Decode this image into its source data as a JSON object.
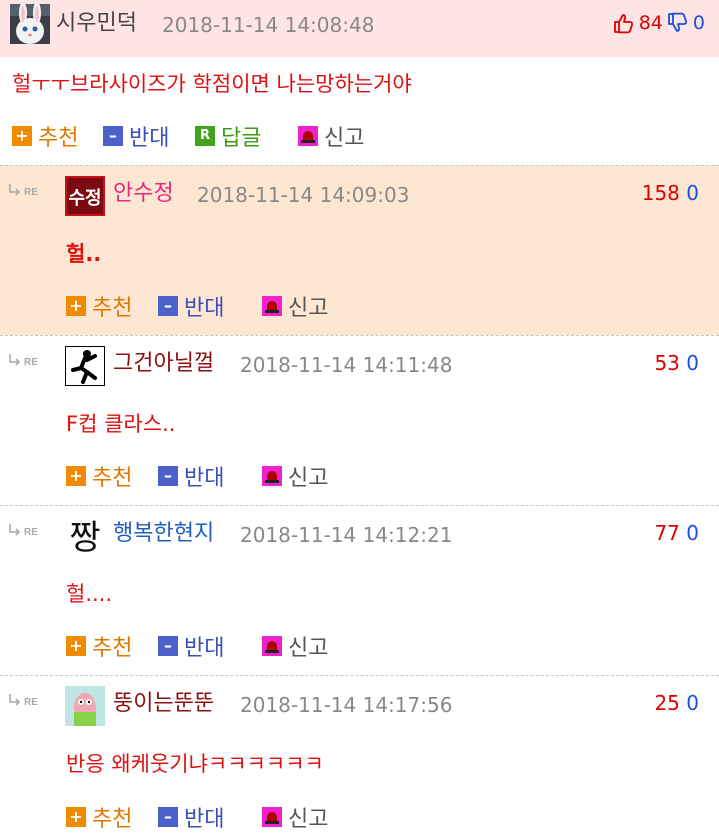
{
  "main": {
    "author": "시우민덕",
    "timestamp": "2018-11-14 14:08:48",
    "upvotes": "84",
    "downvotes": "0",
    "body": "헐ㅜㅜ브라사이즈가 학점이면 나는망하는거야",
    "actions": {
      "recommend": "추천",
      "oppose": "반대",
      "reply": "답글",
      "report": "신고",
      "reply_icon_letter": "R"
    },
    "colors": {
      "header_bg": "#ffe4e6",
      "author": "#444444"
    }
  },
  "replies": [
    {
      "author": "안수정",
      "author_color": "#e8277c",
      "timestamp": "2018-11-14 14:09:03",
      "upvotes": "158",
      "downvotes": "0",
      "body": "헐..",
      "highlighted": true
    },
    {
      "author": "그건아닐껄",
      "author_color": "#8b1010",
      "timestamp": "2018-11-14 14:11:48",
      "upvotes": "53",
      "downvotes": "0",
      "body": "F컵 클라스..",
      "highlighted": false
    },
    {
      "author": "행복한현지",
      "author_color": "#1f5fc0",
      "timestamp": "2018-11-14 14:12:21",
      "upvotes": "77",
      "downvotes": "0",
      "body": "헐....",
      "highlighted": false
    },
    {
      "author": "뚱이는뚠뚠",
      "author_color": "#8b1010",
      "timestamp": "2018-11-14 14:17:56",
      "upvotes": "25",
      "downvotes": "0",
      "body": "반응 왜케웃기냐ㅋㅋㅋㅋㅋㅋ",
      "highlighted": false
    }
  ],
  "reply_actions": {
    "recommend": "추천",
    "oppose": "반대",
    "report": "신고"
  },
  "icons": {
    "main_avatar": "rabbit-avatar-icon",
    "up": "thumbs-up-icon",
    "down": "thumbs-down-icon",
    "re": "reply-arrow-icon",
    "re_label": "RE"
  },
  "avatar_text": {
    "r1": "수정",
    "r3": "짱"
  }
}
